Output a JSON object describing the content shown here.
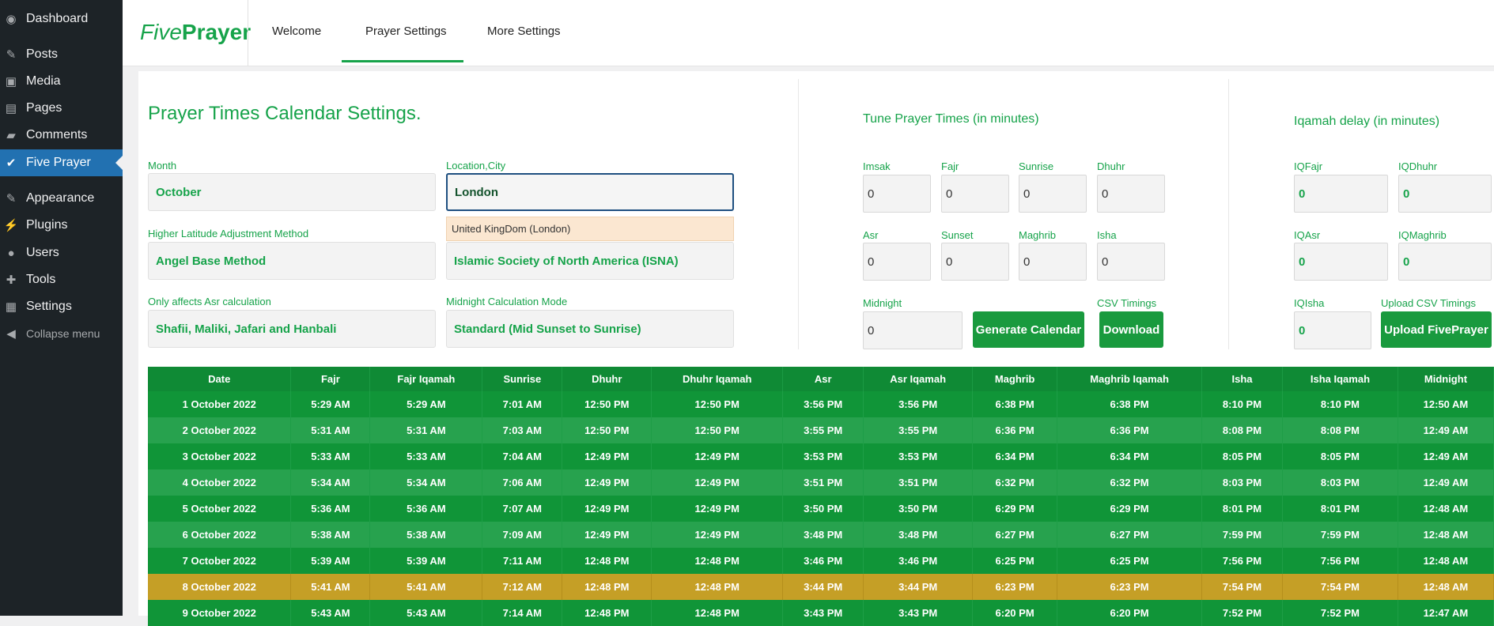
{
  "sidebar": {
    "items": [
      {
        "label": "Dashboard",
        "icon": "dashboard-icon",
        "glyph": "◉"
      },
      {
        "label": "Posts",
        "icon": "pin-icon",
        "glyph": "✎"
      },
      {
        "label": "Media",
        "icon": "media-icon",
        "glyph": "▣"
      },
      {
        "label": "Pages",
        "icon": "pages-icon",
        "glyph": "▤"
      },
      {
        "label": "Comments",
        "icon": "comments-icon",
        "glyph": "▰"
      },
      {
        "label": "Five Prayer",
        "icon": "prayer-icon",
        "glyph": "✔"
      },
      {
        "label": "Appearance",
        "icon": "brush-icon",
        "glyph": "✎"
      },
      {
        "label": "Plugins",
        "icon": "plug-icon",
        "glyph": "⚡"
      },
      {
        "label": "Users",
        "icon": "user-icon",
        "glyph": "●"
      },
      {
        "label": "Tools",
        "icon": "wrench-icon",
        "glyph": "✚"
      },
      {
        "label": "Settings",
        "icon": "settings-icon",
        "glyph": "▦"
      },
      {
        "label": "Collapse menu",
        "icon": "collapse-icon",
        "glyph": "◀"
      }
    ]
  },
  "header": {
    "logo_part1": "Five",
    "logo_part2": "Prayer",
    "tabs": [
      "Welcome",
      "Prayer Settings",
      "More Settings"
    ]
  },
  "settings": {
    "title": "Prayer Times Calendar Settings.",
    "month_label": "Month",
    "month_value": "October",
    "location_label": "Location,City",
    "location_value": "London",
    "autocomplete": "United KingDom (London)",
    "latitude_label": "Higher Latitude Adjustment Method",
    "latitude_value": "Angel Base Method",
    "calc_method_value": "Islamic Society of North America (ISNA)",
    "asr_label": "Only affects Asr calculation",
    "asr_value": "Shafii, Maliki, Jafari and Hanbali",
    "midnight_label": "Midnight Calculation Mode",
    "midnight_value": "Standard (Mid Sunset to Sunrise)"
  },
  "tune": {
    "title": "Tune Prayer Times (in minutes)",
    "fields": [
      {
        "label": "Imsak",
        "value": "0"
      },
      {
        "label": "Fajr",
        "value": "0"
      },
      {
        "label": "Sunrise",
        "value": "0"
      },
      {
        "label": "Dhuhr",
        "value": "0"
      },
      {
        "label": "Asr",
        "value": "0"
      },
      {
        "label": "Sunset",
        "value": "0"
      },
      {
        "label": "Maghrib",
        "value": "0"
      },
      {
        "label": "Isha",
        "value": "0"
      },
      {
        "label": "Midnight",
        "value": "0"
      }
    ],
    "generate_button": "Generate Calendar",
    "csv_label": "CSV Timings",
    "download_button": "Download"
  },
  "iqamah": {
    "title": "Iqamah delay (in minutes)",
    "fields": [
      {
        "label": "IQFajr",
        "value": "0"
      },
      {
        "label": "IQDhuhr",
        "value": "0"
      },
      {
        "label": "IQAsr",
        "value": "0"
      },
      {
        "label": "IQMaghrib",
        "value": "0"
      },
      {
        "label": "IQIsha",
        "value": "0"
      }
    ],
    "upload_label": "Upload CSV Timings",
    "upload_button": "Upload FivePrayer"
  },
  "table": {
    "headers": [
      "Date",
      "Fajr",
      "Fajr Iqamah",
      "Sunrise",
      "Dhuhr",
      "Dhuhr Iqamah",
      "Asr",
      "Asr Iqamah",
      "Maghrib",
      "Maghrib Iqamah",
      "Isha",
      "Isha Iqamah",
      "Midnight"
    ],
    "rows": [
      [
        "1 October 2022",
        "5:29 AM",
        "5:29 AM",
        "7:01 AM",
        "12:50 PM",
        "12:50 PM",
        "3:56 PM",
        "3:56 PM",
        "6:38 PM",
        "6:38 PM",
        "8:10 PM",
        "8:10 PM",
        "12:50 AM"
      ],
      [
        "2 October 2022",
        "5:31 AM",
        "5:31 AM",
        "7:03 AM",
        "12:50 PM",
        "12:50 PM",
        "3:55 PM",
        "3:55 PM",
        "6:36 PM",
        "6:36 PM",
        "8:08 PM",
        "8:08 PM",
        "12:49 AM"
      ],
      [
        "3 October 2022",
        "5:33 AM",
        "5:33 AM",
        "7:04 AM",
        "12:49 PM",
        "12:49 PM",
        "3:53 PM",
        "3:53 PM",
        "6:34 PM",
        "6:34 PM",
        "8:05 PM",
        "8:05 PM",
        "12:49 AM"
      ],
      [
        "4 October 2022",
        "5:34 AM",
        "5:34 AM",
        "7:06 AM",
        "12:49 PM",
        "12:49 PM",
        "3:51 PM",
        "3:51 PM",
        "6:32 PM",
        "6:32 PM",
        "8:03 PM",
        "8:03 PM",
        "12:49 AM"
      ],
      [
        "5 October 2022",
        "5:36 AM",
        "5:36 AM",
        "7:07 AM",
        "12:49 PM",
        "12:49 PM",
        "3:50 PM",
        "3:50 PM",
        "6:29 PM",
        "6:29 PM",
        "8:01 PM",
        "8:01 PM",
        "12:48 AM"
      ],
      [
        "6 October 2022",
        "5:38 AM",
        "5:38 AM",
        "7:09 AM",
        "12:49 PM",
        "12:49 PM",
        "3:48 PM",
        "3:48 PM",
        "6:27 PM",
        "6:27 PM",
        "7:59 PM",
        "7:59 PM",
        "12:48 AM"
      ],
      [
        "7 October 2022",
        "5:39 AM",
        "5:39 AM",
        "7:11 AM",
        "12:48 PM",
        "12:48 PM",
        "3:46 PM",
        "3:46 PM",
        "6:25 PM",
        "6:25 PM",
        "7:56 PM",
        "7:56 PM",
        "12:48 AM"
      ],
      [
        "8 October 2022",
        "5:41 AM",
        "5:41 AM",
        "7:12 AM",
        "12:48 PM",
        "12:48 PM",
        "3:44 PM",
        "3:44 PM",
        "6:23 PM",
        "6:23 PM",
        "7:54 PM",
        "7:54 PM",
        "12:48 AM"
      ],
      [
        "9 October 2022",
        "5:43 AM",
        "5:43 AM",
        "7:14 AM",
        "12:48 PM",
        "12:48 PM",
        "3:43 PM",
        "3:43 PM",
        "6:20 PM",
        "6:20 PM",
        "7:52 PM",
        "7:52 PM",
        "12:47 AM"
      ]
    ],
    "highlight_row": 7
  },
  "colors": {
    "brand_green": "#16a34a",
    "row_dark": "#109538",
    "row_light": "#27a24e",
    "row_highlight": "#c59f26",
    "sidebar_bg": "#1d2327",
    "sidebar_active": "#2271b1"
  }
}
